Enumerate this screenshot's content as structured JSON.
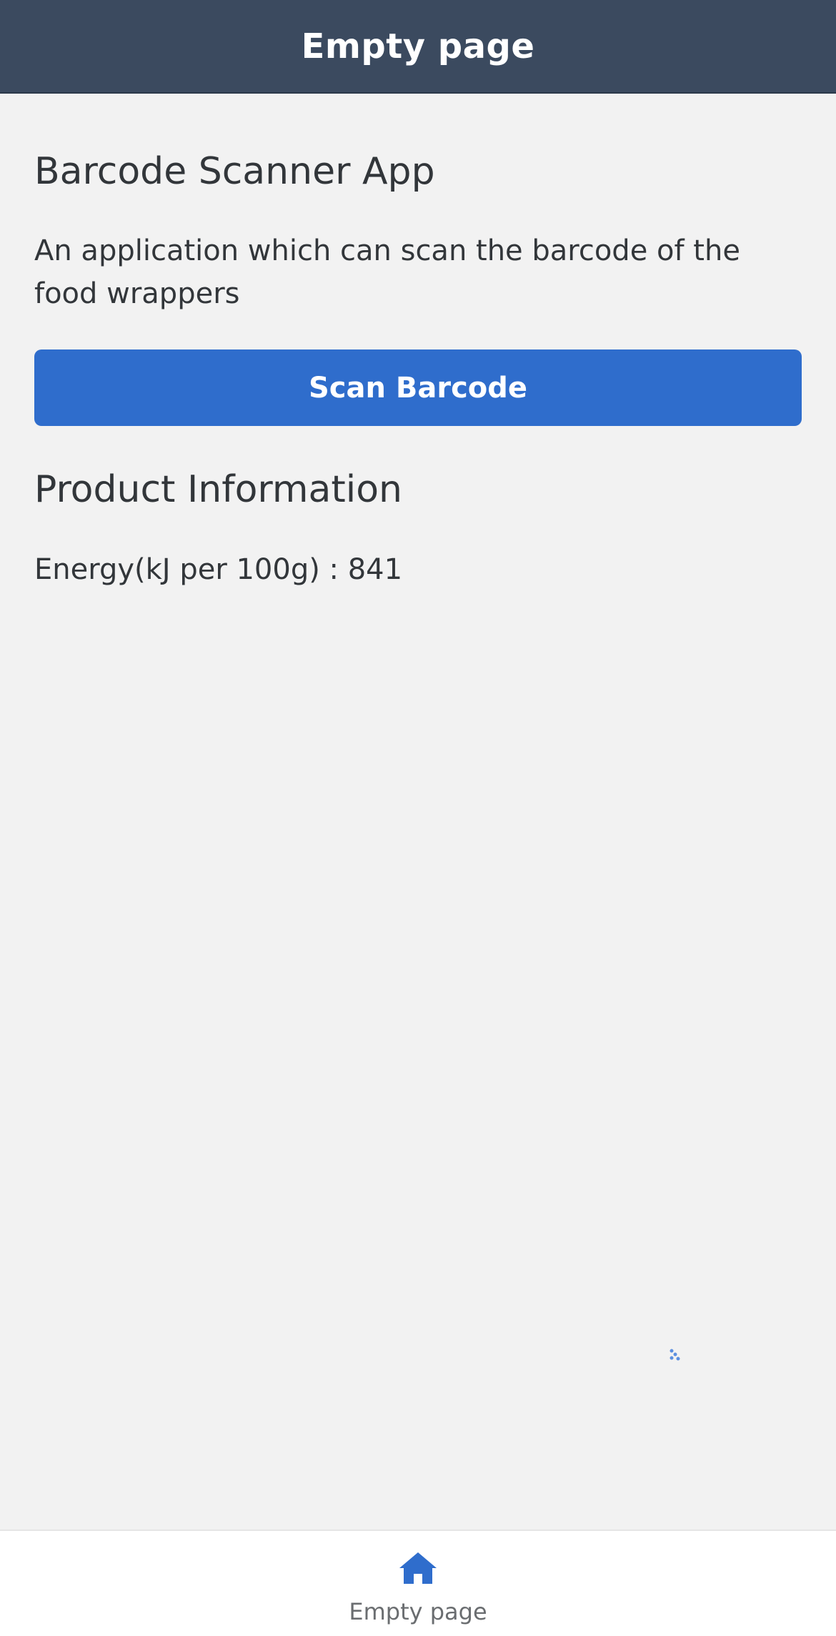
{
  "header": {
    "title": "Empty page"
  },
  "main": {
    "app_title": "Barcode Scanner App",
    "app_description": "An application which can scan the barcode of the food wrappers",
    "scan_button_label": "Scan Barcode",
    "section_title": "Product Information",
    "info_row": "Energy(kJ per 100g) : 841"
  },
  "footer": {
    "tab_label": "Empty page",
    "tab_icon": "home-icon"
  },
  "colors": {
    "header_bg": "#3b4a5f",
    "accent": "#2f6dcc",
    "page_bg": "#f2f2f2",
    "text": "#32363a"
  }
}
